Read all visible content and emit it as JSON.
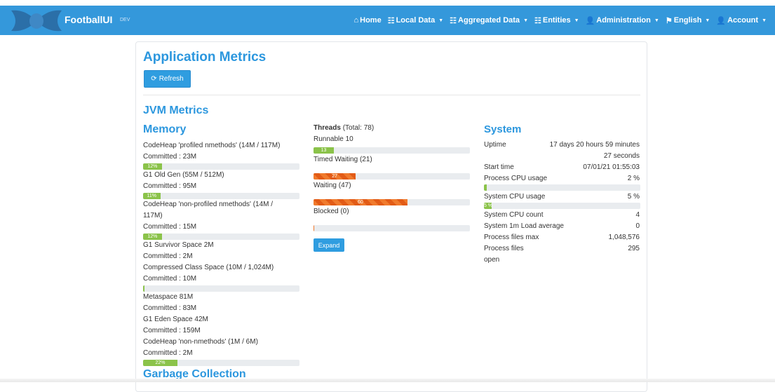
{
  "navbar": {
    "brand": "FootballUI",
    "env": "DEV",
    "items": [
      {
        "icon": "home-icon",
        "glyph": "⌂",
        "label": "Home",
        "caret": false
      },
      {
        "icon": "list-icon",
        "glyph": "☷",
        "label": "Local Data",
        "caret": true
      },
      {
        "icon": "list-icon",
        "glyph": "☷",
        "label": "Aggregated Data",
        "caret": true
      },
      {
        "icon": "list-icon",
        "glyph": "☷",
        "label": "Entities",
        "caret": true
      },
      {
        "icon": "user-plus-icon",
        "glyph": "👤",
        "label": "Administration",
        "caret": true
      },
      {
        "icon": "flag-icon",
        "glyph": "⚑",
        "label": "English",
        "caret": true
      },
      {
        "icon": "user-icon",
        "glyph": "👤",
        "label": "Account",
        "caret": true
      }
    ]
  },
  "page": {
    "title": "Application Metrics",
    "refresh_label": "Refresh",
    "jvm_title": "JVM Metrics",
    "memory_title": "Memory",
    "gc_title": "Garbage Collection",
    "system_title": "System"
  },
  "memory": [
    {
      "name": "CodeHeap 'profiled nmethods' (14M / 117M)",
      "committed": "Committed : 23M",
      "pct": 12,
      "label": "12%"
    },
    {
      "name": "G1 Old Gen (55M / 512M)",
      "committed": "Committed : 95M",
      "pct": 11,
      "label": "11%"
    },
    {
      "name": "CodeHeap 'non-profiled nmethods' (14M /",
      "name2": "117M)",
      "committed": "Committed : 15M",
      "pct": 12,
      "label": "12%"
    },
    {
      "name": "G1 Survivor Space 2M",
      "committed": "Committed : 2M"
    },
    {
      "name": "Compressed Class Space (10M / 1,024M)",
      "committed": "Committed : 10M",
      "pct": 1,
      "label": ""
    },
    {
      "name": "Metaspace 81M",
      "committed": "Committed : 83M"
    },
    {
      "name": "G1 Eden Space 42M",
      "committed": "Committed : 159M"
    },
    {
      "name": "CodeHeap 'non-nmethods' (1M / 6M)",
      "committed": "Committed : 2M",
      "pct": 22,
      "label": "22%"
    }
  ],
  "threads": {
    "title": "Threads",
    "total": "(Total: 78)",
    "runnable": "Runnable 10",
    "items": [
      {
        "label": "13",
        "pct": 13,
        "after": "Timed Waiting (21)",
        "style": "green"
      },
      {
        "label": "27",
        "pct": 27,
        "after": "Waiting (47)",
        "style": "orange"
      },
      {
        "label": "60",
        "pct": 60,
        "after": "Blocked (0)",
        "style": "orange"
      },
      {
        "label": "",
        "pct": 0,
        "after": "",
        "style": "orange"
      }
    ],
    "expand_label": "Expand"
  },
  "system": {
    "uptime_label": "Uptime",
    "uptime_value": "17 days 20 hours 59 minutes",
    "uptime_value2": "27 seconds",
    "start_label": "Start time",
    "start_value": "07/01/21 01:55:03",
    "proc_cpu_label": "Process CPU usage",
    "proc_cpu_value": "2 %",
    "proc_cpu_pct": 2,
    "sys_cpu_label": "System CPU usage",
    "sys_cpu_value": "5 %",
    "sys_cpu_pct": 5,
    "sys_cpu_bar_label": "5 %",
    "cpu_count_label": "System CPU count",
    "cpu_count_value": "4",
    "load_label": "System 1m Load average",
    "load_value": "0",
    "files_max_label": "Process files max",
    "files_max_value": "1,048,576",
    "files_open_label": "Process files",
    "files_open_label2": "open",
    "files_open_value": "295"
  }
}
